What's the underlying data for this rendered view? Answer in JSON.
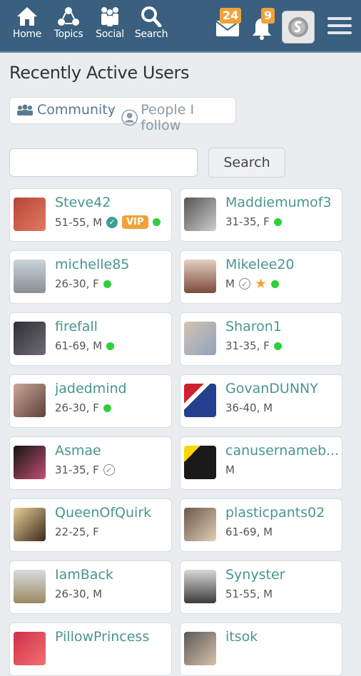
{
  "nav": {
    "home": "Home",
    "topics": "Topics",
    "social": "Social",
    "search": "Search",
    "messages_count": "24",
    "notifications_count": "9"
  },
  "page": {
    "title": "Recently Active Users",
    "filter_community": "Community",
    "filter_separator": "·",
    "filter_follow": "People I follow"
  },
  "search": {
    "button_label": "Search",
    "value": ""
  },
  "colors": {
    "accent": "#49968d",
    "topbar": "#3a5f7f",
    "badge": "#f0a23a",
    "online": "#2fcf3b"
  },
  "users": [
    {
      "name": "Steve42",
      "meta": "51-55, M",
      "verified": "teal",
      "vip": "VIP",
      "star": false,
      "online": true
    },
    {
      "name": "Maddiemumof3",
      "meta": "31-35, F",
      "verified": "",
      "vip": "",
      "star": false,
      "online": true
    },
    {
      "name": "michelle85",
      "meta": "26-30, F",
      "verified": "",
      "vip": "",
      "star": false,
      "online": true
    },
    {
      "name": "Mikelee20",
      "meta": "M",
      "verified": "grey",
      "vip": "",
      "star": true,
      "online": true
    },
    {
      "name": "firefall",
      "meta": "61-69, M",
      "verified": "",
      "vip": "",
      "star": false,
      "online": true
    },
    {
      "name": "Sharon1",
      "meta": "31-35, F",
      "verified": "",
      "vip": "",
      "star": false,
      "online": true
    },
    {
      "name": "jadedmind",
      "meta": "26-30, F",
      "verified": "",
      "vip": "",
      "star": false,
      "online": true
    },
    {
      "name": "GovanDUNNY",
      "meta": "36-40, M",
      "verified": "",
      "vip": "",
      "star": false,
      "online": false
    },
    {
      "name": "Asmae",
      "meta": "31-35, F",
      "verified": "grey",
      "vip": "",
      "star": false,
      "online": false
    },
    {
      "name": "canusernameb...",
      "meta": "M",
      "verified": "",
      "vip": "",
      "star": false,
      "online": false
    },
    {
      "name": "QueenOfQuirk",
      "meta": "22-25, F",
      "verified": "",
      "vip": "",
      "star": false,
      "online": false
    },
    {
      "name": "plasticpants02",
      "meta": "61-69, M",
      "verified": "",
      "vip": "",
      "star": false,
      "online": false
    },
    {
      "name": "IamBack",
      "meta": "26-30, M",
      "verified": "",
      "vip": "",
      "star": false,
      "online": false
    },
    {
      "name": "Synyster",
      "meta": "51-55, M",
      "verified": "",
      "vip": "",
      "star": false,
      "online": false
    },
    {
      "name": "PillowPrincess",
      "meta": "",
      "verified": "",
      "vip": "",
      "star": false,
      "online": false
    },
    {
      "name": "itsok",
      "meta": "",
      "verified": "",
      "vip": "",
      "star": false,
      "online": false
    }
  ]
}
